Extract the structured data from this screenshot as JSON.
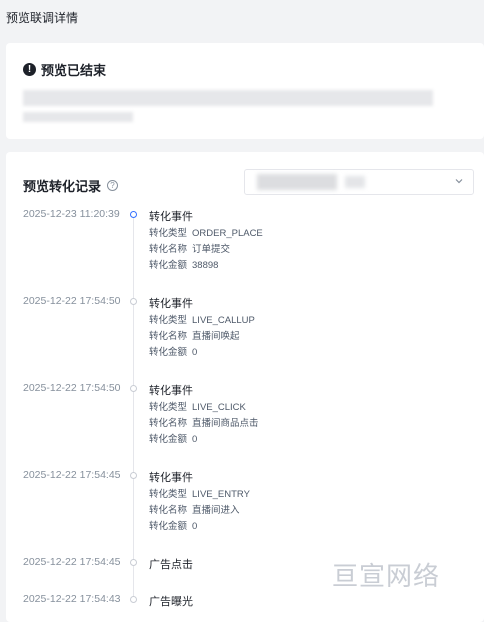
{
  "page": {
    "title": "预览联调详情"
  },
  "status_card": {
    "title": "预览已结束"
  },
  "records": {
    "title": "预览转化记录",
    "items": [
      {
        "time": "2025-12-23 11:20:39",
        "title": "转化事件",
        "active": true,
        "details": [
          {
            "label": "转化类型",
            "value": "ORDER_PLACE"
          },
          {
            "label": "转化名称",
            "value": "订单提交"
          },
          {
            "label": "转化金额",
            "value": "38898"
          }
        ]
      },
      {
        "time": "2025-12-22 17:54:50",
        "title": "转化事件",
        "details": [
          {
            "label": "转化类型",
            "value": "LIVE_CALLUP"
          },
          {
            "label": "转化名称",
            "value": "直播间唤起"
          },
          {
            "label": "转化金额",
            "value": "0"
          }
        ]
      },
      {
        "time": "2025-12-22 17:54:50",
        "title": "转化事件",
        "details": [
          {
            "label": "转化类型",
            "value": "LIVE_CLICK"
          },
          {
            "label": "转化名称",
            "value": "直播间商品点击"
          },
          {
            "label": "转化金额",
            "value": "0"
          }
        ]
      },
      {
        "time": "2025-12-22 17:54:45",
        "title": "转化事件",
        "details": [
          {
            "label": "转化类型",
            "value": "LIVE_ENTRY"
          },
          {
            "label": "转化名称",
            "value": "直播间进入"
          },
          {
            "label": "转化金额",
            "value": "0"
          }
        ]
      },
      {
        "time": "2025-12-22 17:54:45",
        "title": "广告点击",
        "details": []
      },
      {
        "time": "2025-12-22 17:54:43",
        "title": "广告曝光",
        "details": []
      }
    ]
  },
  "watermark": "亘宣网络",
  "colors": {
    "accent": "#3370ff",
    "muted": "#86909c",
    "background": "#f2f3f5"
  }
}
